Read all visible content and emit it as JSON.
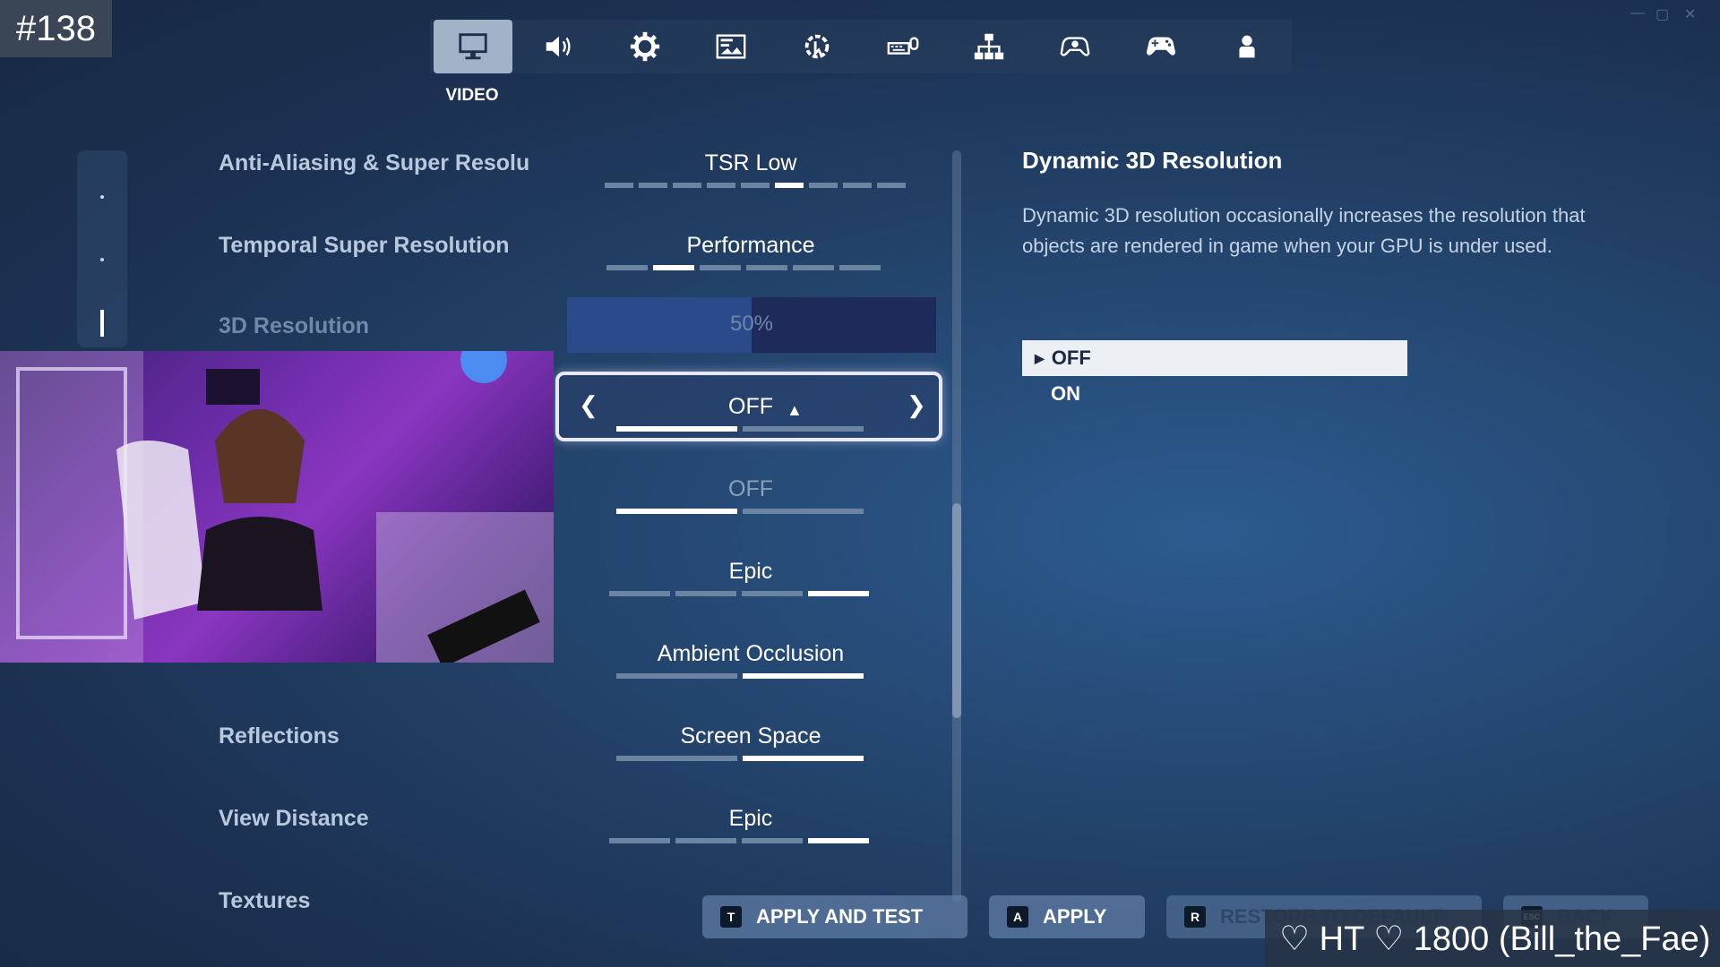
{
  "episode": "#138",
  "nav": {
    "active_label": "VIDEO",
    "tabs": [
      {
        "icon": "monitor-icon"
      },
      {
        "icon": "speaker-icon"
      },
      {
        "icon": "gear-icon"
      },
      {
        "icon": "game-ui-icon"
      },
      {
        "icon": "accessibility-icon"
      },
      {
        "icon": "keyboard-mouse-icon"
      },
      {
        "icon": "network-icon"
      },
      {
        "icon": "controller-settings-icon"
      },
      {
        "icon": "gamepad-icon"
      },
      {
        "icon": "account-icon"
      }
    ]
  },
  "settings": [
    {
      "label": "Anti-Aliasing & Super Resolu",
      "value": "TSR Low",
      "segments": 9,
      "active": 5
    },
    {
      "label": "Temporal Super Resolution",
      "value": "Performance",
      "segments": 6,
      "active": 1
    },
    {
      "label": "3D Resolution",
      "value": "50%",
      "level": 0.5
    },
    {
      "label": "",
      "value": "OFF",
      "segments": 2,
      "active": 0
    },
    {
      "label": "",
      "value": "OFF",
      "segments": 2,
      "active": 0
    },
    {
      "label": "",
      "value": "Epic",
      "segments": 4,
      "active": 3
    },
    {
      "label": "",
      "value": "Ambient Occlusion",
      "segments": 2,
      "active": 1
    },
    {
      "label": "Reflections",
      "value": "Screen Space",
      "segments": 2,
      "active": 1
    },
    {
      "label": "View Distance",
      "value": "Epic",
      "segments": 4,
      "active": 3
    },
    {
      "label": "Textures",
      "value": ""
    }
  ],
  "description": {
    "title": "Dynamic 3D Resolution",
    "body": "Dynamic 3D resolution occasionally increases the resolution that objects are rendered in game when your GPU is under used.",
    "options": [
      "OFF",
      "ON"
    ],
    "selected": "OFF"
  },
  "buttons": {
    "apply_test": {
      "key": "T",
      "label": "APPLY AND TEST"
    },
    "apply": {
      "key": "A",
      "label": "APPLY"
    },
    "restore": {
      "key": "R",
      "label": "RESTORE TO DEFAULT"
    },
    "back": {
      "key": "ESC",
      "label": "BACK"
    }
  },
  "overlay_text": "♡ HT ♡ 1800 (Bill_the_Fae)"
}
